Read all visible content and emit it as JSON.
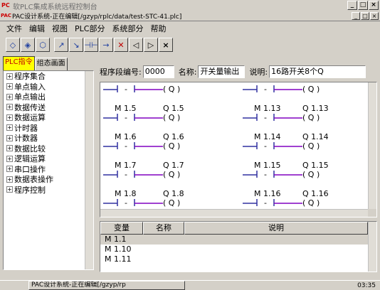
{
  "window": {
    "title": "软PLC集成系统远程控制台",
    "logo": "PC"
  },
  "mdi": {
    "title": "PAC设计系统-正在编辑[/gzyp/rplc/data/test-STC-41.plc]",
    "logo": "PAC"
  },
  "title_buttons": [
    "_",
    "□",
    "×"
  ],
  "menu": [
    "文件",
    "编辑",
    "视图",
    "PLC部分",
    "系统部分",
    "帮助"
  ],
  "toolbar": {
    "icons": [
      "open-icon",
      "edit-icon",
      "save-icon",
      "up-arrow-icon",
      "down-arrow-icon",
      "branch-icon",
      "right-arrow-icon",
      "delete-icon",
      "left-triangle-icon",
      "right-triangle-icon",
      "close-icon"
    ],
    "glyphs": [
      "◇",
      "◈",
      "⬡",
      "↗",
      "↘",
      "⊣⊢",
      "→",
      "✕",
      "◁",
      "▷",
      "×"
    ]
  },
  "left_panel": {
    "tabs": [
      "PLC指令",
      "组态画面"
    ],
    "tree": [
      "程序集合",
      "单点输入",
      "单点输出",
      "数据传送",
      "数据运算",
      "计时器",
      "计数器",
      "数据比较",
      "逻辑运算",
      "串口操作",
      "数据表操作",
      "程序控制"
    ]
  },
  "info": {
    "program_no_label": "程序段编号:",
    "program_no": "0000",
    "name_label": "名称:",
    "name": "开关量输出",
    "desc_label": "说明:",
    "desc": "16路开关8个Q"
  },
  "ladder": {
    "left": [
      {
        "m": "M 1.5",
        "q": "Q 1.5"
      },
      {
        "m": "M 1.6",
        "q": "Q 1.6"
      },
      {
        "m": "M 1.7",
        "q": "Q 1.7"
      },
      {
        "m": "M 1.8",
        "q": "Q 1.8"
      }
    ],
    "right": [
      {
        "m": "M 1.13",
        "q": "Q 1.13"
      },
      {
        "m": "M 1.14",
        "q": "Q 1.14"
      },
      {
        "m": "M 1.15",
        "q": "Q 1.15"
      },
      {
        "m": "M 1.16",
        "q": "Q 1.16"
      }
    ],
    "contact_mid": "-",
    "coil_text": "( Q )"
  },
  "table": {
    "headers": [
      "变量",
      "名称",
      "说明"
    ],
    "rows": [
      "M 1.1",
      "M 1.10",
      "M 1.11"
    ]
  },
  "taskbar": {
    "task": "PAC设计系统-正在编辑[/gzyp/rp",
    "clock": "03:35"
  },
  "colors": {
    "tab_active_bg": "#ffff00",
    "tab_active_fg": "#c00000",
    "ladder_line": "#3030a0",
    "coil_line": "#8000c0"
  }
}
